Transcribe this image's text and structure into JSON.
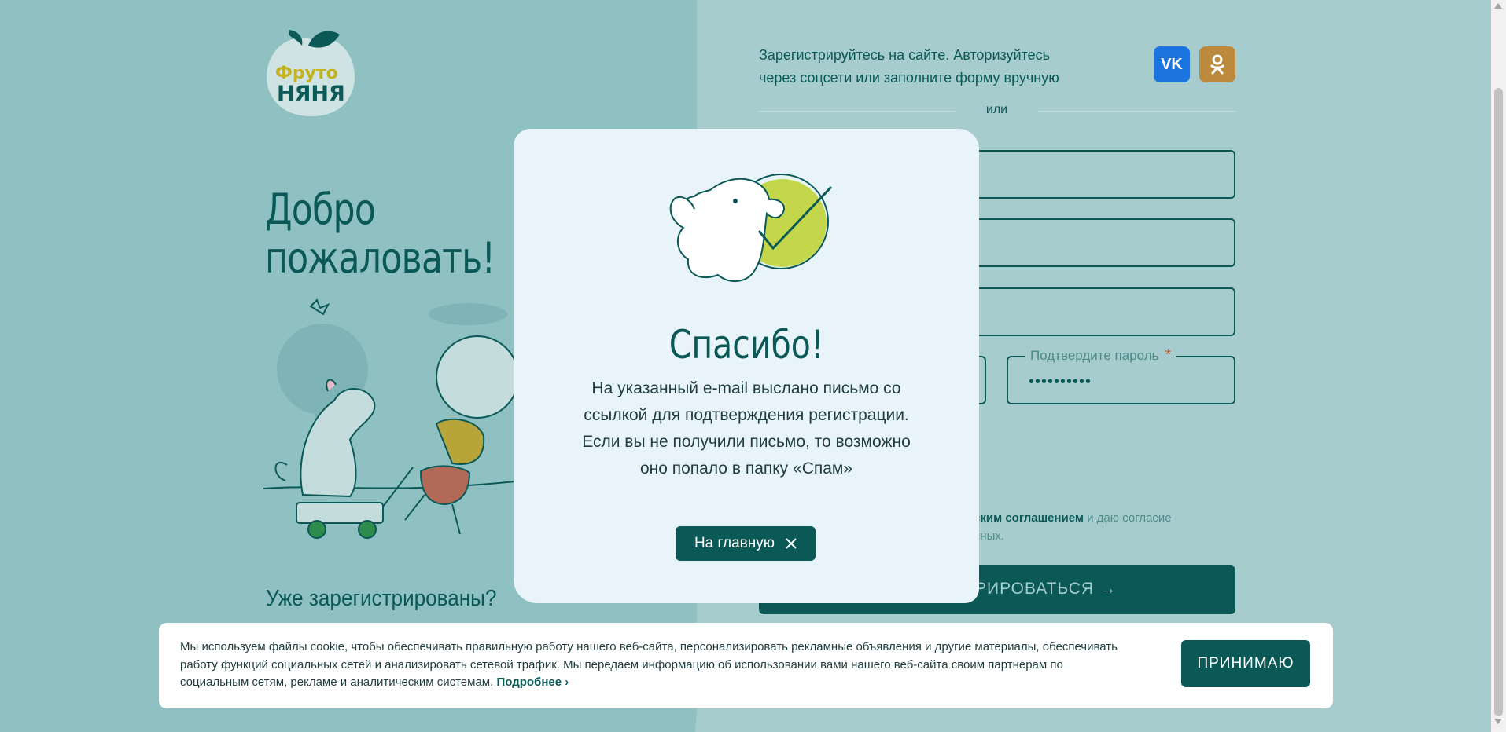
{
  "brand": {
    "logo_line1": "Фруто",
    "logo_line2": "НЯНЯ"
  },
  "left": {
    "welcome_line1": "Добро",
    "welcome_line2": "пожаловать!",
    "already_registered": "Уже зарегистрированы?"
  },
  "right": {
    "social_text_line1": "Зарегистрируйтесь на сайте. Авторизуйтесь",
    "social_text_line2": "через соцсети или заполните форму вручную",
    "vk_label": "VK",
    "or_label": "или",
    "confirm_password_label": "Подтвердите пароль",
    "required_mark": "*",
    "confirm_password_value": "••••••••••",
    "agree_link": "ским соглашением",
    "agree_after": " и даю согласие",
    "agree_line2": "нных.",
    "register_label": "РИРОВАТЬСЯ →"
  },
  "modal": {
    "title": "Спасибо!",
    "text": "На указанный e-mail выслано письмо со ссылкой для подтверждения регистрации. Если вы не получили письмо, то возможно оно попало в папку «Спам»",
    "button_label": "На главную",
    "button_icon": "close-icon"
  },
  "cookie": {
    "text": "Мы используем файлы cookie, чтобы обеспечивать правильную работу нашего веб-сайта, персонализировать рекламные объявления и другие материалы, обеспечивать работу функций социальных сетей и анализировать сетевой трафик. Мы передаем информацию об использовании вами нашего веб-сайта своим партнерам по социальным сетям, рекламе и аналитическим системам.",
    "more_link": "Подробнее ›",
    "accept_label": "ПРИНИМАЮ"
  },
  "colors": {
    "primary": "#0b5957",
    "bg_left": "#8fc1c3",
    "bg_right": "#a7cccd",
    "vk": "#1b74e0",
    "ok": "#bb8a3c",
    "accent_green": "#c4d64a"
  }
}
